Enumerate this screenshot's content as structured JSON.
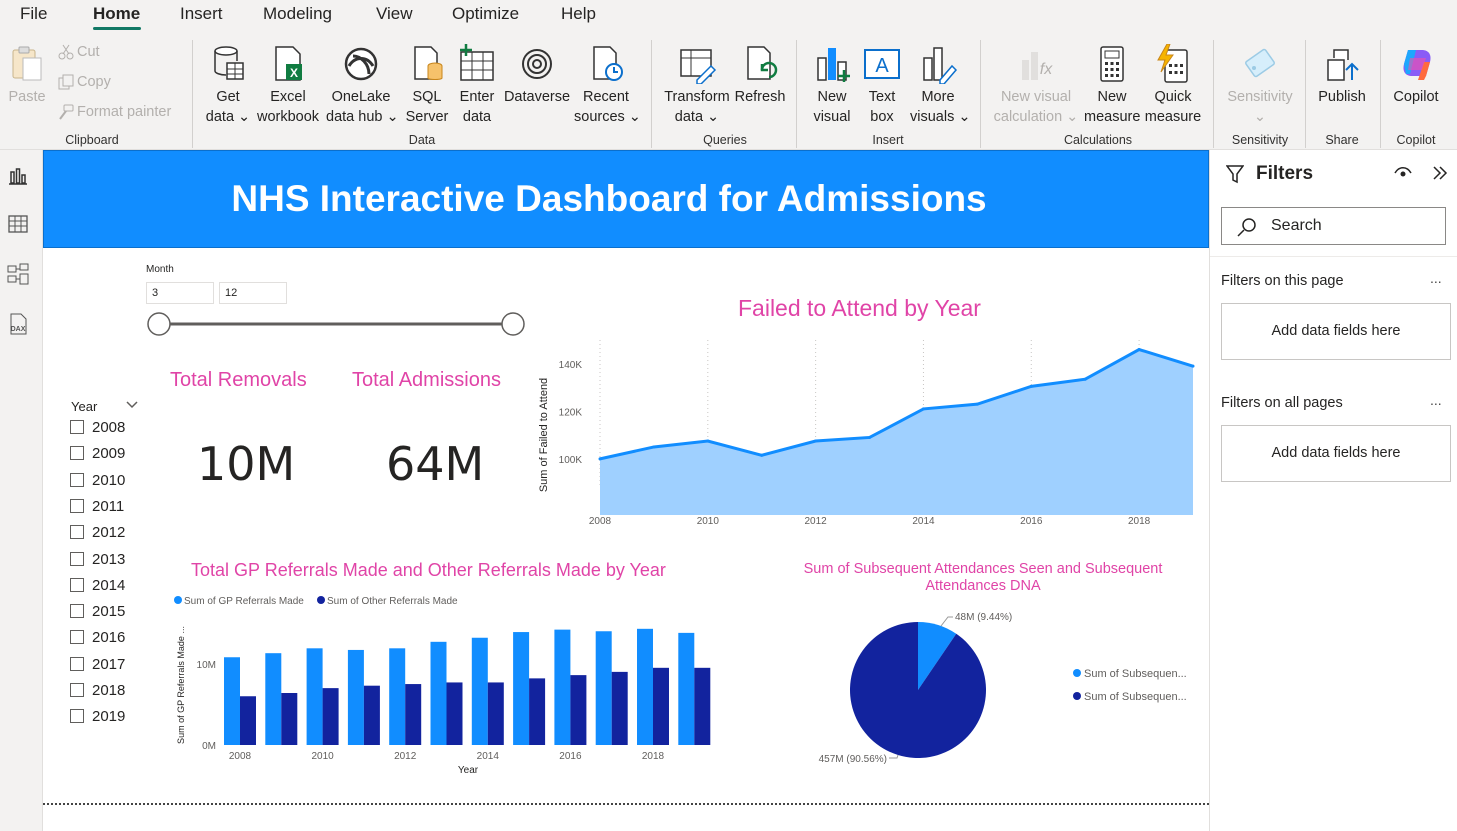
{
  "menu": {
    "items": [
      "File",
      "Home",
      "Insert",
      "Modeling",
      "View",
      "Optimize",
      "Help"
    ],
    "active": "Home"
  },
  "ribbon": {
    "clipboard": {
      "paste": "Paste",
      "cut": "Cut",
      "copy": "Copy",
      "format_painter": "Format painter",
      "group": "Clipboard"
    },
    "data": {
      "get_data": [
        "Get",
        "data"
      ],
      "excel": [
        "Excel",
        "workbook"
      ],
      "onelake": [
        "OneLake",
        "data hub"
      ],
      "sql": [
        "SQL",
        "Server"
      ],
      "enter": [
        "Enter",
        "data"
      ],
      "dataverse": "Dataverse",
      "recent": [
        "Recent",
        "sources"
      ],
      "group": "Data"
    },
    "queries": {
      "transform": [
        "Transform",
        "data"
      ],
      "refresh": "Refresh",
      "group": "Queries"
    },
    "insert": {
      "new_visual": [
        "New",
        "visual"
      ],
      "text_box": [
        "Text",
        "box"
      ],
      "more_visuals": [
        "More",
        "visuals"
      ],
      "group": "Insert"
    },
    "calculations": {
      "new_visual_calc": [
        "New visual",
        "calculation"
      ],
      "new_measure": [
        "New",
        "measure"
      ],
      "quick_measure": [
        "Quick",
        "measure"
      ],
      "group": "Calculations"
    },
    "sensitivity": {
      "label": "Sensitivity",
      "group": "Sensitivity"
    },
    "share": {
      "publish": "Publish",
      "group": "Share"
    },
    "copilot": {
      "label": "Copilot",
      "group": "Copilot"
    }
  },
  "report": {
    "title": "NHS Interactive Dashboard for Admissions",
    "month_slicer": {
      "label": "Month",
      "min": "3",
      "max": "12"
    },
    "year_slicer": {
      "label": "Year",
      "years": [
        "2008",
        "2009",
        "2010",
        "2011",
        "2012",
        "2013",
        "2014",
        "2015",
        "2016",
        "2017",
        "2018",
        "2019"
      ]
    },
    "kpis": [
      {
        "title": "Total Removals",
        "value": "10M"
      },
      {
        "title": "Total Admissions",
        "value": "64M"
      }
    ]
  },
  "filters": {
    "title": "Filters",
    "search_placeholder": "Search",
    "on_this_page": "Filters on this page",
    "on_all_pages": "Filters on all pages",
    "add_fields": "Add data fields here",
    "more": "..."
  },
  "colors": {
    "accent": "#118dff",
    "dark_blue": "#12239e",
    "title_pink": "#e044a7",
    "area_fill": "#9fd0ff"
  },
  "chart_data": [
    {
      "type": "area",
      "title": "Failed to Attend by Year",
      "ylabel": "Sum of Failed to Attend",
      "xlabel": "",
      "x": [
        2008,
        2009,
        2010,
        2011,
        2012,
        2013,
        2014,
        2015,
        2016,
        2017,
        2018,
        2019
      ],
      "series": [
        {
          "values": [
            100000,
            105000,
            107500,
            101500,
            107500,
            109000,
            121000,
            123000,
            130500,
            133500,
            146000,
            139000
          ]
        }
      ],
      "ylim": [
        89000,
        150000
      ],
      "yticks": [
        "100K",
        "120K",
        "140K"
      ],
      "xticks": [
        "2008",
        "2010",
        "2012",
        "2014",
        "2016",
        "2018"
      ],
      "grid": true
    },
    {
      "type": "bar",
      "title": "Total GP Referrals Made and Other Referrals Made by Year",
      "xlabel": "Year",
      "ylabel": "Sum of GP Referrals Made ...",
      "categories": [
        "2008",
        "2009",
        "2010",
        "2011",
        "2012",
        "2013",
        "2014",
        "2015",
        "2016",
        "2017",
        "2018",
        "2019"
      ],
      "series": [
        {
          "name": "Sum of GP Referrals Made",
          "values": [
            10.8,
            11.3,
            11.9,
            11.7,
            11.9,
            12.7,
            13.2,
            13.9,
            14.2,
            14.0,
            14.3,
            13.8
          ]
        },
        {
          "name": "Sum of Other Referrals Made",
          "values": [
            6.0,
            6.4,
            7.0,
            7.3,
            7.5,
            7.7,
            7.7,
            8.2,
            8.6,
            9.0,
            9.5,
            9.5
          ]
        }
      ],
      "ylim": [
        0,
        16
      ],
      "yticks": [
        "0M",
        "10M"
      ],
      "xticks": [
        "2008",
        "2010",
        "2012",
        "2014",
        "2016",
        "2018"
      ],
      "legend": "top-left"
    },
    {
      "type": "pie",
      "title": "Sum of Subsequent Attendances Seen and Subsequent Attendances DNA",
      "slices": [
        {
          "name": "Sum of Subsequen...",
          "value": 48,
          "label": "48M (9.44%)"
        },
        {
          "name": "Sum of Subsequen...",
          "value": 457,
          "label": "457M (90.56%)"
        }
      ],
      "legend": "right"
    }
  ]
}
